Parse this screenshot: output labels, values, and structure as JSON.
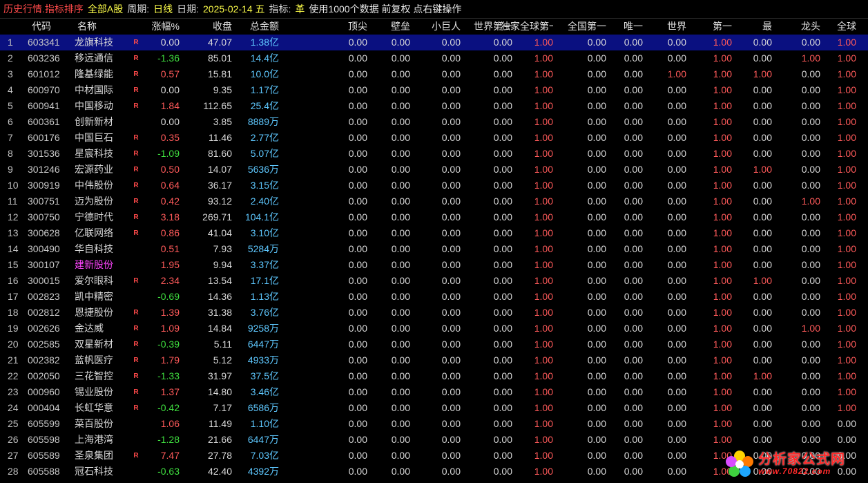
{
  "topbar": {
    "title": "历史行情.指标排序",
    "filter": "全部A股",
    "period_label": "周期:",
    "period_value": "日线",
    "date_label": "日期:",
    "date_value": "2025-02-14 五",
    "indicator_label": "指标:",
    "indicator_value": "革",
    "extra": "使用1000个数据 前复权 点右键操作"
  },
  "colors": {
    "accent": "#ff4a4a",
    "selected_row_bg": "#0a1080",
    "up": "#ff5a5a",
    "down": "#3fdf3f",
    "amount": "#5ec8ff"
  },
  "sort": {
    "column": "独家全球第一",
    "direction": "descending",
    "indicator_icon": "arrow-down-icon"
  },
  "columns": {
    "code": "代码",
    "name": "名称",
    "chg": "涨幅%",
    "close": "收盘",
    "amount": "总金额",
    "indicators": [
      "顶尖",
      "壁垒",
      "小巨人",
      "世界第一",
      "独家全球第一",
      "全国第一",
      "唯一",
      "世界",
      "第一",
      "最",
      "龙头",
      "全球"
    ]
  },
  "rows": [
    {
      "idx": "1",
      "code": "603341",
      "name": "龙旗科技",
      "r": "R",
      "chg": "0.00",
      "close": "47.07",
      "amt": "1.38亿",
      "ind": [
        "0.00",
        "0.00",
        "0.00",
        "0.00",
        "0.00",
        "1.00",
        "0.00",
        "0.00",
        "0.00",
        "1.00",
        "0.00",
        "0.00",
        "1.00"
      ]
    },
    {
      "idx": "2",
      "code": "603236",
      "name": "移远通信",
      "r": "R",
      "chg": "-1.36",
      "close": "85.01",
      "amt": "14.4亿",
      "ind": [
        "0.00",
        "0.00",
        "0.00",
        "0.00",
        "0.00",
        "1.00",
        "0.00",
        "0.00",
        "0.00",
        "1.00",
        "0.00",
        "1.00",
        "1.00"
      ]
    },
    {
      "idx": "3",
      "code": "601012",
      "name": "隆基绿能",
      "r": "R",
      "chg": "0.57",
      "close": "15.81",
      "amt": "10.0亿",
      "ind": [
        "0.00",
        "0.00",
        "0.00",
        "0.00",
        "0.00",
        "1.00",
        "0.00",
        "0.00",
        "1.00",
        "1.00",
        "1.00",
        "0.00",
        "1.00"
      ]
    },
    {
      "idx": "4",
      "code": "600970",
      "name": "中材国际",
      "r": "R",
      "chg": "0.00",
      "close": "9.35",
      "amt": "1.17亿",
      "ind": [
        "0.00",
        "0.00",
        "0.00",
        "0.00",
        "0.00",
        "1.00",
        "0.00",
        "0.00",
        "0.00",
        "1.00",
        "0.00",
        "0.00",
        "1.00"
      ]
    },
    {
      "idx": "5",
      "code": "600941",
      "name": "中国移动",
      "r": "R",
      "chg": "1.84",
      "close": "112.65",
      "amt": "25.4亿",
      "ind": [
        "0.00",
        "0.00",
        "0.00",
        "0.00",
        "0.00",
        "1.00",
        "0.00",
        "0.00",
        "0.00",
        "1.00",
        "0.00",
        "0.00",
        "1.00"
      ]
    },
    {
      "idx": "6",
      "code": "600361",
      "name": "创新新材",
      "r": "",
      "chg": "0.00",
      "close": "3.85",
      "amt": "8889万",
      "ind": [
        "0.00",
        "0.00",
        "0.00",
        "0.00",
        "0.00",
        "1.00",
        "0.00",
        "0.00",
        "0.00",
        "1.00",
        "0.00",
        "0.00",
        "1.00"
      ]
    },
    {
      "idx": "7",
      "code": "600176",
      "name": "中国巨石",
      "r": "R",
      "chg": "0.35",
      "close": "11.46",
      "amt": "2.77亿",
      "ind": [
        "0.00",
        "0.00",
        "0.00",
        "0.00",
        "0.00",
        "1.00",
        "0.00",
        "0.00",
        "0.00",
        "1.00",
        "0.00",
        "0.00",
        "1.00"
      ]
    },
    {
      "idx": "8",
      "code": "301536",
      "name": "星宸科技",
      "r": "R",
      "chg": "-1.09",
      "close": "81.60",
      "amt": "5.07亿",
      "ind": [
        "0.00",
        "0.00",
        "0.00",
        "0.00",
        "0.00",
        "1.00",
        "0.00",
        "0.00",
        "0.00",
        "1.00",
        "0.00",
        "0.00",
        "1.00"
      ]
    },
    {
      "idx": "9",
      "code": "301246",
      "name": "宏源药业",
      "r": "R",
      "chg": "0.50",
      "close": "14.07",
      "amt": "5636万",
      "ind": [
        "0.00",
        "0.00",
        "0.00",
        "0.00",
        "0.00",
        "1.00",
        "0.00",
        "0.00",
        "0.00",
        "1.00",
        "1.00",
        "0.00",
        "1.00"
      ]
    },
    {
      "idx": "10",
      "code": "300919",
      "name": "中伟股份",
      "r": "R",
      "chg": "0.64",
      "close": "36.17",
      "amt": "3.15亿",
      "ind": [
        "0.00",
        "0.00",
        "0.00",
        "0.00",
        "0.00",
        "1.00",
        "0.00",
        "0.00",
        "0.00",
        "1.00",
        "0.00",
        "0.00",
        "1.00"
      ]
    },
    {
      "idx": "11",
      "code": "300751",
      "name": "迈为股份",
      "r": "R",
      "chg": "0.42",
      "close": "93.12",
      "amt": "2.40亿",
      "ind": [
        "0.00",
        "0.00",
        "0.00",
        "0.00",
        "0.00",
        "1.00",
        "0.00",
        "0.00",
        "0.00",
        "1.00",
        "0.00",
        "1.00",
        "1.00"
      ]
    },
    {
      "idx": "12",
      "code": "300750",
      "name": "宁德时代",
      "r": "R",
      "chg": "3.18",
      "close": "269.71",
      "amt": "104.1亿",
      "ind": [
        "0.00",
        "0.00",
        "0.00",
        "0.00",
        "0.00",
        "1.00",
        "0.00",
        "0.00",
        "0.00",
        "1.00",
        "0.00",
        "0.00",
        "1.00"
      ]
    },
    {
      "idx": "13",
      "code": "300628",
      "name": "亿联网络",
      "r": "R",
      "chg": "0.86",
      "close": "41.04",
      "amt": "3.10亿",
      "ind": [
        "0.00",
        "0.00",
        "0.00",
        "0.00",
        "0.00",
        "1.00",
        "0.00",
        "0.00",
        "0.00",
        "1.00",
        "0.00",
        "0.00",
        "1.00"
      ]
    },
    {
      "idx": "14",
      "code": "300490",
      "name": "华自科技",
      "r": "",
      "chg": "0.51",
      "close": "7.93",
      "amt": "5284万",
      "ind": [
        "0.00",
        "0.00",
        "0.00",
        "0.00",
        "0.00",
        "1.00",
        "0.00",
        "0.00",
        "0.00",
        "1.00",
        "0.00",
        "0.00",
        "1.00"
      ]
    },
    {
      "idx": "15",
      "code": "300107",
      "name": "建新股份",
      "r": "",
      "chg": "1.95",
      "close": "9.94",
      "amt": "3.37亿",
      "pink": true,
      "ind": [
        "0.00",
        "0.00",
        "0.00",
        "0.00",
        "0.00",
        "1.00",
        "0.00",
        "0.00",
        "0.00",
        "1.00",
        "0.00",
        "0.00",
        "1.00"
      ]
    },
    {
      "idx": "16",
      "code": "300015",
      "name": "爱尔眼科",
      "r": "R",
      "chg": "2.34",
      "close": "13.54",
      "amt": "17.1亿",
      "ind": [
        "0.00",
        "0.00",
        "0.00",
        "0.00",
        "0.00",
        "1.00",
        "0.00",
        "0.00",
        "0.00",
        "1.00",
        "1.00",
        "0.00",
        "1.00"
      ]
    },
    {
      "idx": "17",
      "code": "002823",
      "name": "凯中精密",
      "r": "",
      "chg": "-0.69",
      "close": "14.36",
      "amt": "1.13亿",
      "ind": [
        "0.00",
        "0.00",
        "0.00",
        "0.00",
        "0.00",
        "1.00",
        "0.00",
        "0.00",
        "0.00",
        "1.00",
        "0.00",
        "0.00",
        "1.00"
      ]
    },
    {
      "idx": "18",
      "code": "002812",
      "name": "恩捷股份",
      "r": "R",
      "chg": "1.39",
      "close": "31.38",
      "amt": "3.76亿",
      "ind": [
        "0.00",
        "0.00",
        "0.00",
        "0.00",
        "0.00",
        "1.00",
        "0.00",
        "0.00",
        "0.00",
        "1.00",
        "0.00",
        "0.00",
        "1.00"
      ]
    },
    {
      "idx": "19",
      "code": "002626",
      "name": "金达威",
      "r": "R",
      "chg": "1.09",
      "close": "14.84",
      "amt": "9258万",
      "ind": [
        "0.00",
        "0.00",
        "0.00",
        "0.00",
        "0.00",
        "1.00",
        "0.00",
        "0.00",
        "0.00",
        "1.00",
        "0.00",
        "1.00",
        "1.00"
      ]
    },
    {
      "idx": "20",
      "code": "002585",
      "name": "双星新材",
      "r": "R",
      "chg": "-0.39",
      "close": "5.11",
      "amt": "6447万",
      "ind": [
        "0.00",
        "0.00",
        "0.00",
        "0.00",
        "0.00",
        "1.00",
        "0.00",
        "0.00",
        "0.00",
        "1.00",
        "0.00",
        "0.00",
        "1.00"
      ]
    },
    {
      "idx": "21",
      "code": "002382",
      "name": "蓝帆医疗",
      "r": "R",
      "chg": "1.79",
      "close": "5.12",
      "amt": "4933万",
      "ind": [
        "0.00",
        "0.00",
        "0.00",
        "0.00",
        "0.00",
        "1.00",
        "0.00",
        "0.00",
        "0.00",
        "1.00",
        "0.00",
        "0.00",
        "1.00"
      ]
    },
    {
      "idx": "22",
      "code": "002050",
      "name": "三花智控",
      "r": "R",
      "chg": "-1.33",
      "close": "31.97",
      "amt": "37.5亿",
      "ind": [
        "0.00",
        "0.00",
        "0.00",
        "0.00",
        "0.00",
        "1.00",
        "0.00",
        "0.00",
        "0.00",
        "1.00",
        "1.00",
        "0.00",
        "1.00"
      ]
    },
    {
      "idx": "23",
      "code": "000960",
      "name": "锡业股份",
      "r": "R",
      "chg": "1.37",
      "close": "14.80",
      "amt": "3.46亿",
      "ind": [
        "0.00",
        "0.00",
        "0.00",
        "0.00",
        "0.00",
        "1.00",
        "0.00",
        "0.00",
        "0.00",
        "1.00",
        "0.00",
        "0.00",
        "1.00"
      ]
    },
    {
      "idx": "24",
      "code": "000404",
      "name": "长虹华意",
      "r": "R",
      "chg": "-0.42",
      "close": "7.17",
      "amt": "6586万",
      "ind": [
        "0.00",
        "0.00",
        "0.00",
        "0.00",
        "0.00",
        "1.00",
        "0.00",
        "0.00",
        "0.00",
        "1.00",
        "0.00",
        "0.00",
        "1.00"
      ]
    },
    {
      "idx": "25",
      "code": "605599",
      "name": "菜百股份",
      "r": "",
      "chg": "1.06",
      "close": "11.49",
      "amt": "1.10亿",
      "ind": [
        "0.00",
        "0.00",
        "0.00",
        "0.00",
        "0.00",
        "1.00",
        "0.00",
        "0.00",
        "0.00",
        "1.00",
        "0.00",
        "0.00",
        "0.00"
      ]
    },
    {
      "idx": "26",
      "code": "605598",
      "name": "上海港湾",
      "r": "",
      "chg": "-1.28",
      "close": "21.66",
      "amt": "6447万",
      "ind": [
        "0.00",
        "0.00",
        "0.00",
        "0.00",
        "0.00",
        "1.00",
        "0.00",
        "0.00",
        "0.00",
        "1.00",
        "0.00",
        "0.00",
        "0.00"
      ]
    },
    {
      "idx": "27",
      "code": "605589",
      "name": "圣泉集团",
      "r": "R",
      "chg": "7.47",
      "close": "27.78",
      "amt": "7.03亿",
      "ind": [
        "0.00",
        "0.00",
        "0.00",
        "0.00",
        "0.00",
        "1.00",
        "0.00",
        "0.00",
        "0.00",
        "1.00",
        "0.00",
        "0.00",
        "0.00"
      ]
    },
    {
      "idx": "28",
      "code": "605588",
      "name": "冠石科技",
      "r": "",
      "chg": "-0.63",
      "close": "42.40",
      "amt": "4392万",
      "ind": [
        "0.00",
        "0.00",
        "0.00",
        "0.00",
        "0.00",
        "1.00",
        "0.00",
        "0.00",
        "0.00",
        "1.00",
        "0.00",
        "0.00",
        "0.00"
      ]
    }
  ],
  "watermark": {
    "brand": "分析家公式网",
    "url": "www.70822.com",
    "icon": "flower-logo-icon"
  }
}
